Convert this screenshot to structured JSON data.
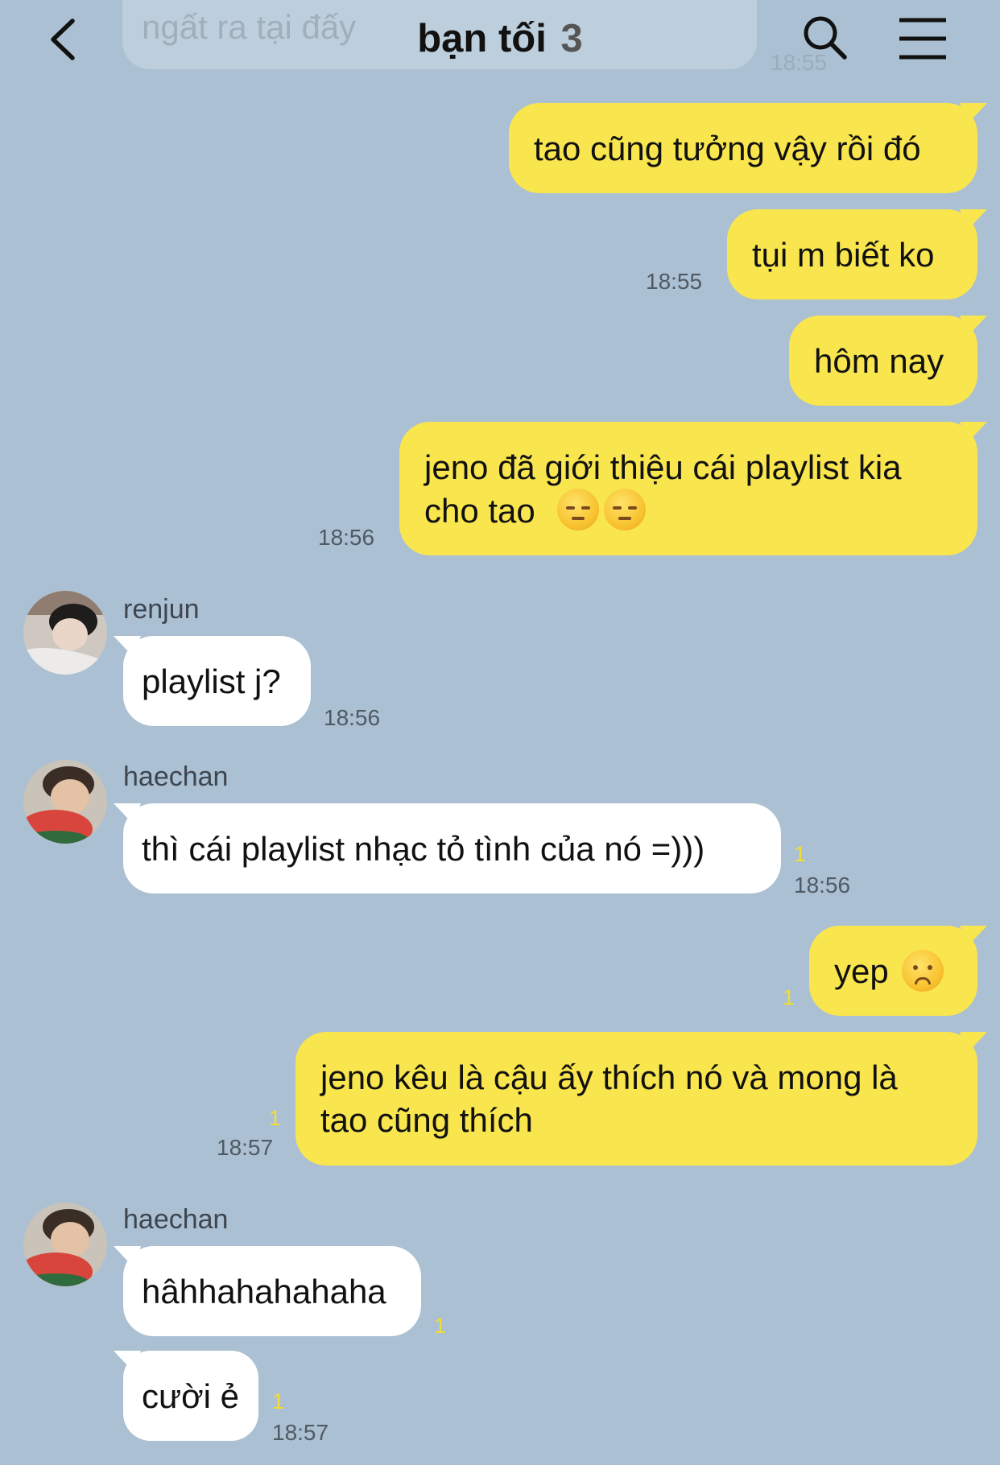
{
  "header": {
    "title": "bạn tối",
    "member_count": "3",
    "back_icon": "chevron-left-icon",
    "search_icon": "search-icon",
    "menu_icon": "hamburger-menu-icon"
  },
  "ghost": {
    "text": "ngất ra tại đấy",
    "time": "18:55"
  },
  "messages": {
    "m1": {
      "text": "tao cũng tưởng vậy rồi đó"
    },
    "m2": {
      "text": "tụi m biết ko",
      "time": "18:55"
    },
    "m3": {
      "text": "hôm nay"
    },
    "m4": {
      "line1": "jeno đã giới thiệu cái playlist kia",
      "line2": "cho tao",
      "emoji": "pensive-face",
      "time": "18:56"
    },
    "m5": {
      "sender": "renjun",
      "text": "playlist j?",
      "time": "18:56"
    },
    "m6": {
      "sender": "haechan",
      "text": "thì cái playlist nhạc tỏ tình của nó =)))",
      "unread": "1",
      "time": "18:56"
    },
    "m7": {
      "text": "yep",
      "emoji": "disappointed-face",
      "unread": "1"
    },
    "m8": {
      "line1": "jeno kêu là cậu ấy thích nó và mong là",
      "line2": "tao cũng thích",
      "unread": "1",
      "time": "18:57"
    },
    "m9": {
      "sender": "haechan",
      "text": "hâhhahahahaha",
      "unread": "1"
    },
    "m10": {
      "text": "cười ẻ",
      "unread": "1",
      "time": "18:57"
    }
  },
  "colors": {
    "background": "#abc0d2",
    "my_bubble": "#f9e54e",
    "their_bubble": "#ffffff",
    "unread": "#f2dd32"
  }
}
